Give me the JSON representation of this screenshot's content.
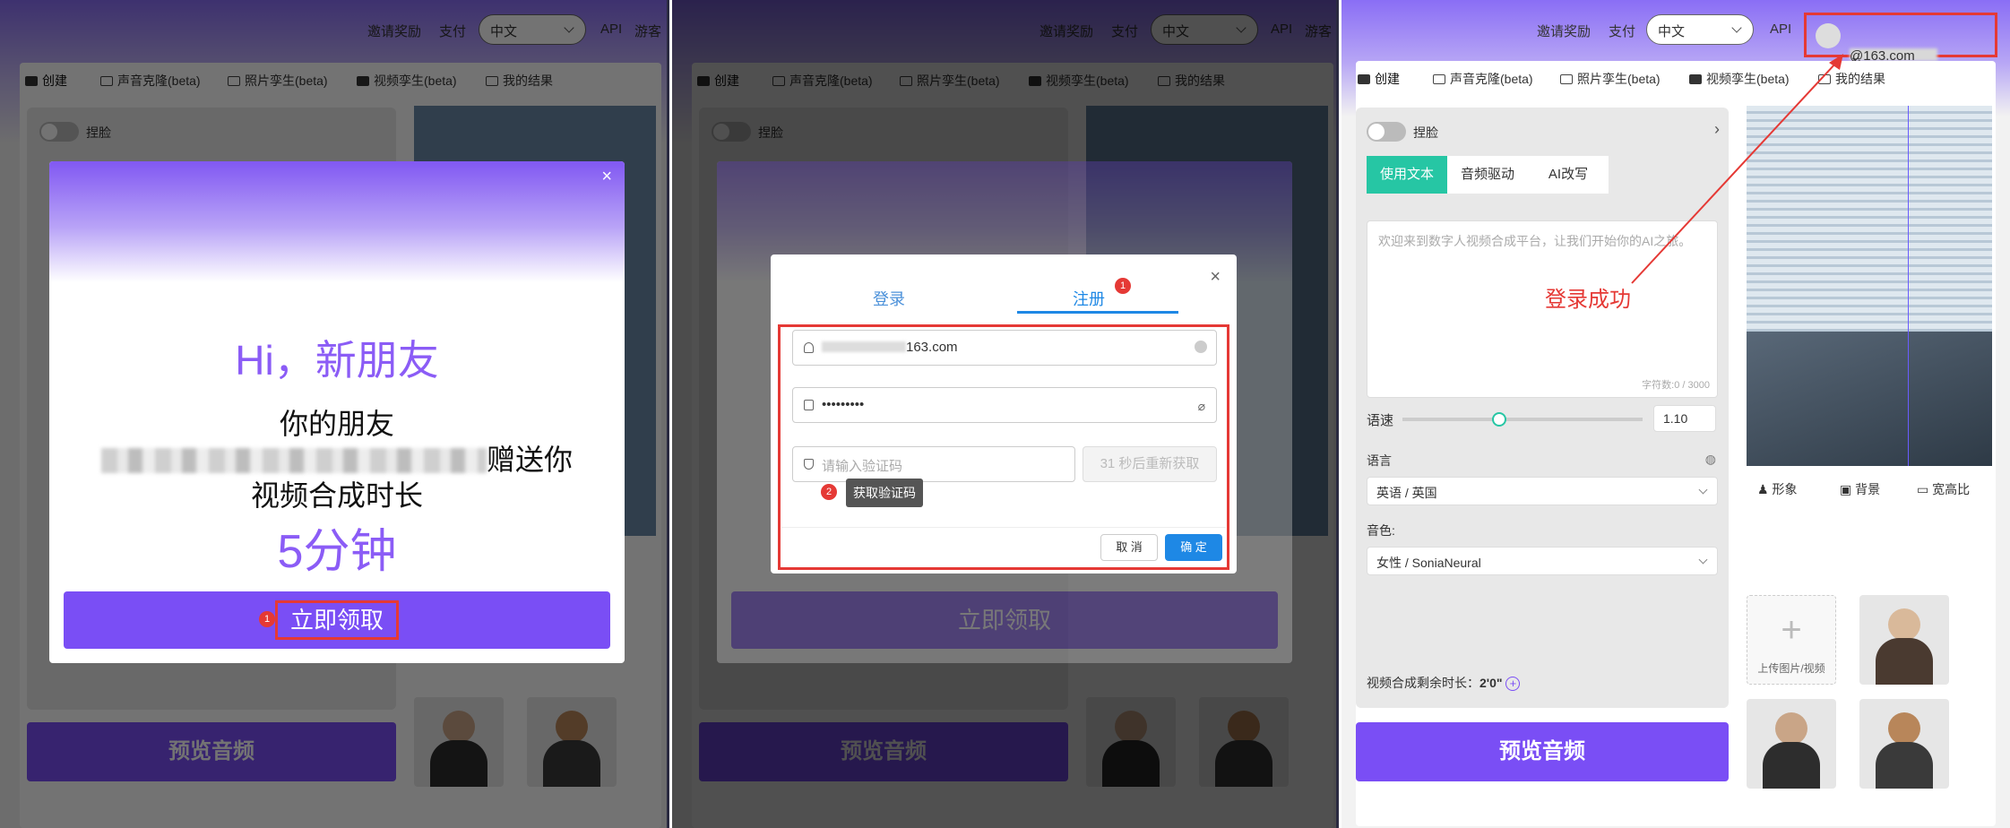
{
  "header": {
    "invite": "邀请奖励",
    "pay": "支付",
    "language": "中文",
    "api": "API",
    "guest": "游客"
  },
  "tabs": [
    "创建",
    "声音克隆(beta)",
    "照片孪生(beta)",
    "视频孪生(beta)",
    "我的结果"
  ],
  "common": {
    "face_swap": "捏脸",
    "preview_audio": "预览音频"
  },
  "promo": {
    "greeting": "Hi，新朋友",
    "line1": "你的朋友",
    "line2_suffix": "赠送你",
    "line3": "视频合成时长",
    "minutes": "5分钟",
    "claim": "立即领取",
    "close": "×",
    "badge": "1"
  },
  "login": {
    "tab_login": "登录",
    "tab_register": "注册",
    "register_badge": "1",
    "close": "×",
    "email_suffix": "163.com",
    "password": "•••••••••",
    "code_placeholder": "请输入验证码",
    "resend": "31 秒后重新获取",
    "tip_badge": "2",
    "tip": "获取验证码",
    "cancel": "取 消",
    "ok": "确 定"
  },
  "panel3": {
    "user_suffix": "@163.com",
    "seg": [
      "使用文本",
      "音频驱动",
      "AI改写"
    ],
    "textarea_placeholder": "欢迎来到数字人视频合成平台，让我们开始你的AI之旅。",
    "char_count": "字符数:0 / 3000",
    "speed_label": "语速",
    "speed_value": "1.10",
    "language_label": "语言",
    "language_value": "英语 / 英国",
    "voice_label": "音色:",
    "voice_value": "女性 / SoniaNeural",
    "sub_tabs": [
      "形象",
      "背景",
      "宽高比"
    ],
    "upload": "上传图片/视频",
    "remaining_label": "视频合成剩余时长：",
    "remaining_value": "2'0\"",
    "annotation": "登录成功"
  },
  "colors": {
    "accent": "#7a4ef5",
    "teal": "#26c6a4",
    "red": "#e53935",
    "blue": "#1e88e5"
  }
}
